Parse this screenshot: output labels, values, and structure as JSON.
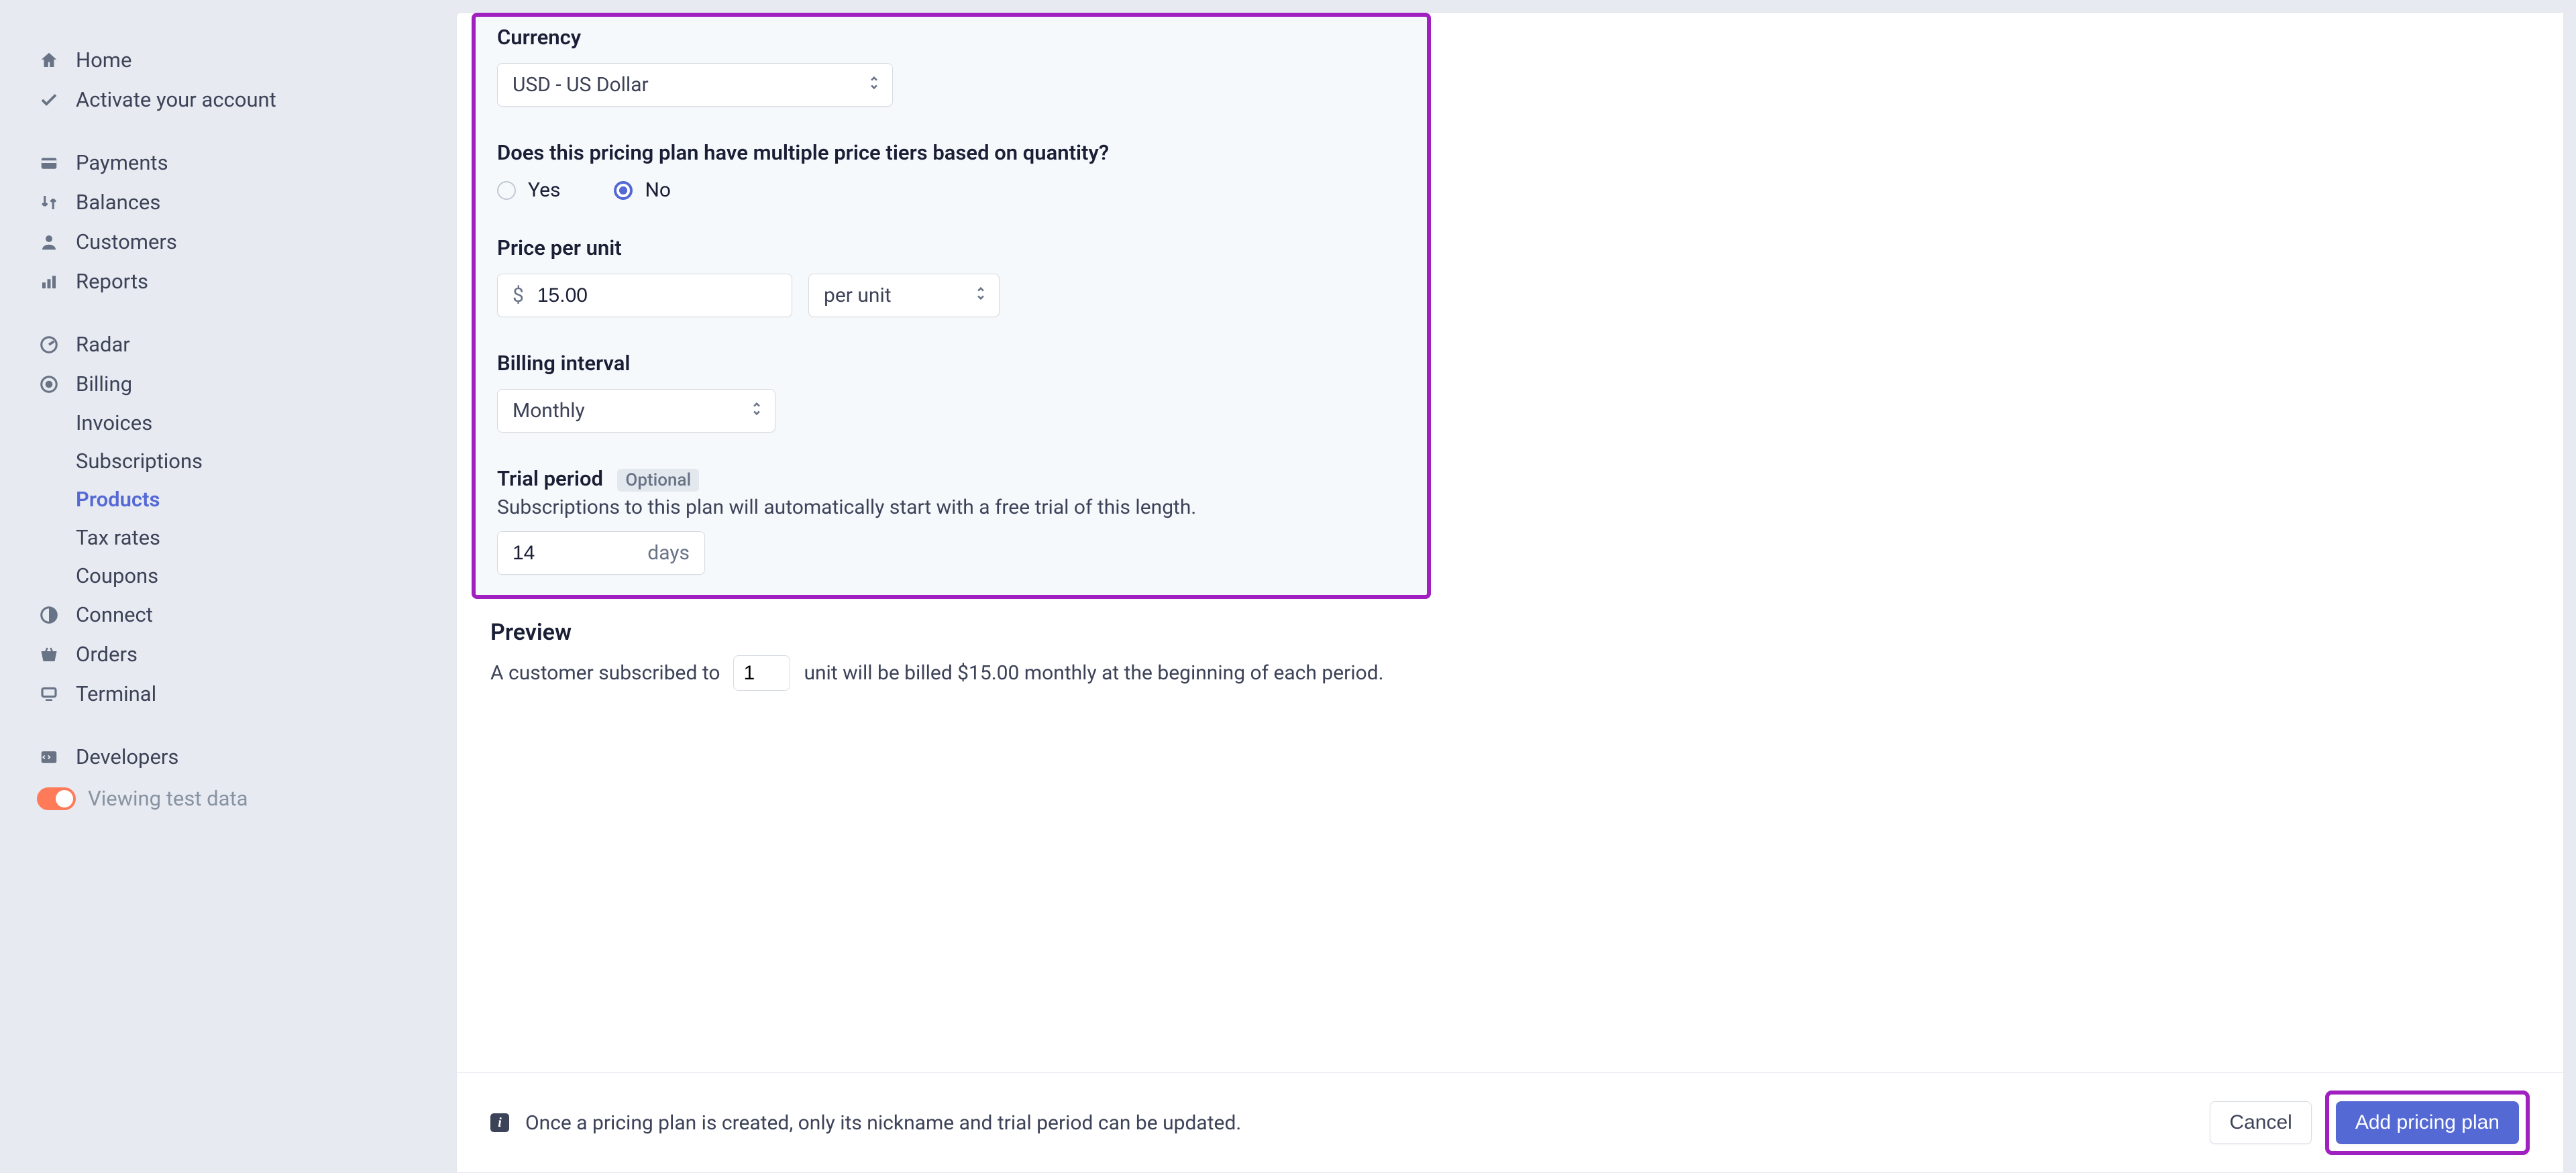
{
  "sidebar": {
    "items": [
      {
        "label": "Home"
      },
      {
        "label": "Activate your account"
      },
      {
        "label": "Payments"
      },
      {
        "label": "Balances"
      },
      {
        "label": "Customers"
      },
      {
        "label": "Reports"
      },
      {
        "label": "Radar"
      },
      {
        "label": "Billing"
      },
      {
        "label": "Connect"
      },
      {
        "label": "Orders"
      },
      {
        "label": "Terminal"
      },
      {
        "label": "Developers"
      }
    ],
    "billing_sub": [
      {
        "label": "Invoices"
      },
      {
        "label": "Subscriptions"
      },
      {
        "label": "Products"
      },
      {
        "label": "Tax rates"
      },
      {
        "label": "Coupons"
      }
    ],
    "test_mode_label": "Viewing test data"
  },
  "form": {
    "currency_label": "Currency",
    "currency_value": "USD - US Dollar",
    "tiers_question": "Does this pricing plan have multiple price tiers based on quantity?",
    "yes": "Yes",
    "no": "No",
    "price_label": "Price per unit",
    "price_currency_symbol": "$",
    "price_value": "15.00",
    "per_unit": "per unit",
    "interval_label": "Billing interval",
    "interval_value": "Monthly",
    "trial_label": "Trial period",
    "optional_badge": "Optional",
    "trial_help": "Subscriptions to this plan will automatically start with a free trial of this length.",
    "trial_value": "14",
    "trial_suffix": "days"
  },
  "preview": {
    "title": "Preview",
    "prefix": "A customer subscribed to",
    "unit_value": "1",
    "suffix": "unit will be billed $15.00 monthly at the beginning of each period."
  },
  "footer": {
    "note": "Once a pricing plan is created, only its nickname and trial period can be updated.",
    "cancel": "Cancel",
    "submit": "Add pricing plan"
  }
}
